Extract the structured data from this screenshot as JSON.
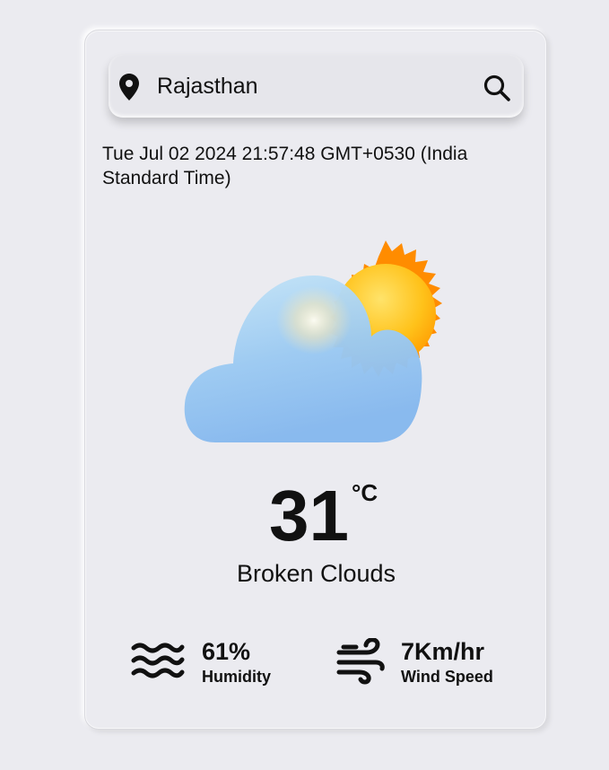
{
  "search": {
    "location": "Rajasthan",
    "pin_icon": "map-pin-icon",
    "search_icon": "magnifier-icon"
  },
  "datetime": "Tue Jul 02 2024 21:57:48 GMT+0530 (India Standard Time)",
  "weather": {
    "icon": "partly-cloudy-icon",
    "temperature": "31",
    "unit": "°C",
    "description": "Broken Clouds"
  },
  "stats": {
    "humidity": {
      "value": "61%",
      "label": "Humidity",
      "icon": "waves-icon"
    },
    "wind": {
      "value": "7Km/hr",
      "label": "Wind Speed",
      "icon": "wind-icon"
    }
  },
  "colors": {
    "background": "#ebebf0",
    "text": "#111111"
  }
}
